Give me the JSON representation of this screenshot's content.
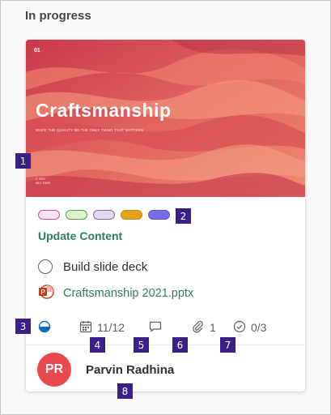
{
  "section": {
    "title": "In progress"
  },
  "card": {
    "cover": {
      "number": "01",
      "title": "Craftsmanship",
      "subtitle": "MAKE THE QUALITY BE THE ONLY THING THAT MATTERS",
      "footer_line1": "Z. INDY",
      "footer_line2": "WILL PARE"
    },
    "labels": [
      {
        "fill": "#fbe3ef",
        "border": "#d04d94"
      },
      {
        "fill": "#dff3d4",
        "border": "#5aa33b"
      },
      {
        "fill": "#e3d9ec",
        "border": "#8a63b0"
      },
      {
        "fill": "#e3a21a",
        "border": "#c78a0f"
      },
      {
        "fill": "#7a6ee8",
        "border": "#5f52cf"
      }
    ],
    "task_title": "Update Content",
    "checklist_item": "Build slide deck",
    "attachment_name": "Craftsmanship 2021.pptx",
    "meta": {
      "progress_icon": "half-circle-progress-icon",
      "due_date": "11/12",
      "comments_icon": "comment-icon",
      "attachments_count": "1",
      "checklist_progress": "0/3"
    },
    "assignee": {
      "initials": "PR",
      "name": "Parvin Radhina"
    }
  },
  "markers": [
    "1",
    "2",
    "3",
    "4",
    "5",
    "6",
    "7",
    "8"
  ],
  "colors": {
    "accent_green": "#2e7d5b",
    "marker": "#3b1f8a",
    "avatar": "#e8494f"
  }
}
